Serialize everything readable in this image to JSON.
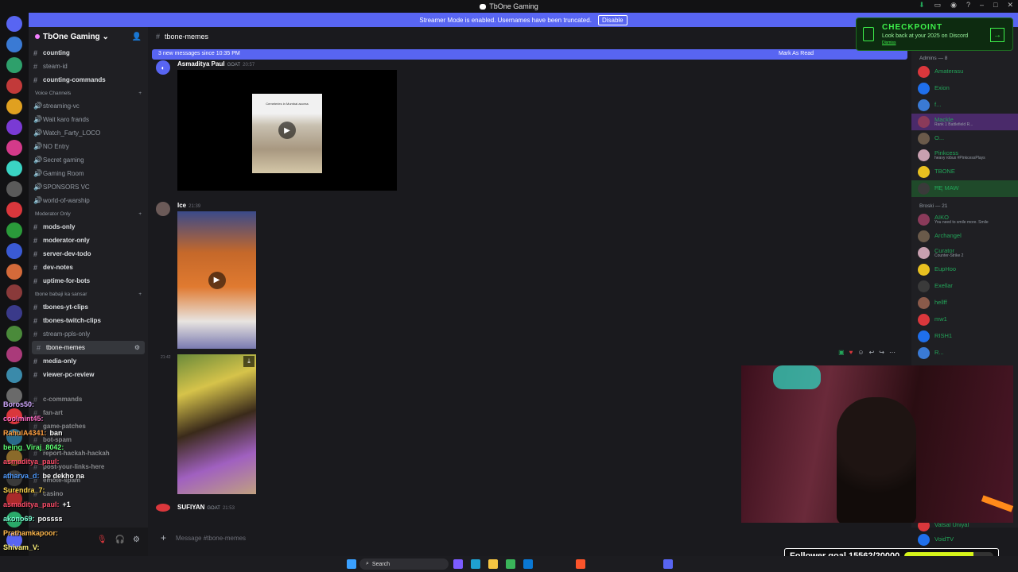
{
  "window": {
    "title": "TbOne Gaming"
  },
  "banner": {
    "text": "Streamer Mode is enabled. Usernames have been truncated.",
    "disable_label": "Disable"
  },
  "server": {
    "name": "TbOne Gaming"
  },
  "channels": [
    {
      "label": "counting",
      "style": "bright"
    },
    {
      "label": "steam-id",
      "style": "dim"
    },
    {
      "label": "counting-commands",
      "style": "bright"
    }
  ],
  "cat_voice": "Voice Channels",
  "voice": [
    "streaming-vc",
    "Wait karo frands",
    "Watch_Farty_LOCO",
    "NO Entry",
    "Secret gaming",
    "Gaming Room",
    "SPONSORS VC",
    "world-of-warship"
  ],
  "cat_mod": "Moderator Only",
  "mod": [
    {
      "label": "mods-only",
      "style": "bright"
    },
    {
      "label": "moderator-only",
      "style": "bright"
    },
    {
      "label": "server-dev-todo",
      "style": "bright"
    },
    {
      "label": "dev-notes",
      "style": "bright"
    },
    {
      "label": "uptime-for-bots",
      "style": "bright"
    }
  ],
  "cat_tbone": "tbone babaji ka sansar",
  "tbone": [
    {
      "label": "tbones-yt-clips",
      "style": "bright"
    },
    {
      "label": "tbones-twitch-clips",
      "style": "bright"
    },
    {
      "label": "stream-ppls-only",
      "style": "dim"
    },
    {
      "label": "tbone-memes",
      "style": "active"
    },
    {
      "label": "media-only",
      "style": "bright"
    },
    {
      "label": "viewer-pc-review",
      "style": "bright"
    }
  ],
  "lower_channels": [
    "c-commands",
    "fan-art",
    "game-patches",
    "bot-spam",
    "report-hackah-hackah",
    "post-your-links-here",
    "emote-spam",
    "casino"
  ],
  "channel_header": {
    "name": "tbone-memes"
  },
  "new_messages": {
    "text": "3 new messages since 10:35 PM",
    "mark": "Mark As Read"
  },
  "messages": [
    {
      "user": "Asmaditya Paul",
      "role": "GOAT",
      "time": "20:57",
      "media_caption": "Cemeteries in Mumbai access"
    },
    {
      "user": "Ice",
      "role": "",
      "time": "21:39"
    },
    {
      "time": "21:42"
    },
    {
      "user": "SUFIYAN",
      "role": "GOAT",
      "time": "21:53"
    }
  ],
  "composer": {
    "placeholder": "Message #tbone-memes"
  },
  "checkpoint": {
    "title": "CHECKPOINT",
    "subtitle": "Look back at your 2025 on Discord",
    "link": "Dismiss"
  },
  "members": {
    "admins_label": "Admins — 8",
    "admins": [
      {
        "name": "Amaterasu",
        "sub": "",
        "color": "#23a559"
      },
      {
        "name": "Exion",
        "sub": "",
        "color": "#23a559"
      },
      {
        "name": "f...",
        "sub": "",
        "color": "#23a559"
      },
      {
        "name": "Mackle",
        "sub": "Rank 1 Battlefield R...",
        "color": "#23a559"
      },
      {
        "name": "O...",
        "sub": "",
        "color": "#23a559"
      },
      {
        "name": "Pinkcess",
        "sub": "heavy robux #PinkcessPlays",
        "color": "#23a559"
      },
      {
        "name": "TBONE",
        "sub": "",
        "color": "#23a559"
      },
      {
        "name": "ĦĘ MAW",
        "sub": "",
        "color": "#23a559"
      }
    ],
    "broski_label": "Broski — 21",
    "broski": [
      {
        "name": "AIKO",
        "sub": "You need to smile more. Smile",
        "color": "#23a559"
      },
      {
        "name": "Archangel",
        "sub": "",
        "color": "#23a559"
      },
      {
        "name": "Curator",
        "sub": "Counter-Strike 2",
        "color": "#23a559"
      },
      {
        "name": "EupHoo",
        "sub": "",
        "color": "#23a559"
      },
      {
        "name": "Exellar",
        "sub": "",
        "color": "#23a559"
      },
      {
        "name": "hellff",
        "sub": "",
        "color": "#23a559"
      },
      {
        "name": "mw1",
        "sub": "",
        "color": "#23a559"
      },
      {
        "name": "RISH1",
        "sub": "",
        "color": "#23a559"
      },
      {
        "name": "R...",
        "sub": "",
        "color": "#23a559"
      }
    ],
    "bottom": [
      {
        "name": "Vatsal Uniyal",
        "color": "#23a559"
      },
      {
        "name": "VoidTV",
        "color": "#23a559"
      }
    ]
  },
  "chat_overlay": [
    {
      "user": "Boros50:",
      "msg": "",
      "color": "#d1a8ff"
    },
    {
      "user": "coolmint45:",
      "msg": "",
      "color": "#ff6ec7"
    },
    {
      "user": "RahulA4341:",
      "msg": "ban",
      "color": "#ff9f40"
    },
    {
      "user": "being_Viraj_8042:",
      "msg": "",
      "color": "#5dff72"
    },
    {
      "user": "asmaditya_paul:",
      "msg": "",
      "color": "#ff4d6a"
    },
    {
      "user": "atharva_d:",
      "msg": "be dekho na",
      "color": "#4d9aff"
    },
    {
      "user": "Surendra_7:",
      "msg": "",
      "color": "#ffd84d"
    },
    {
      "user": "asmaditya_paul:",
      "msg": "+1",
      "color": "#ff4d6a"
    },
    {
      "user": "akono69:",
      "msg": "possss",
      "color": "#7cffd4"
    },
    {
      "user": "Prathamkapoor:",
      "msg": "",
      "color": "#ffb84d"
    },
    {
      "user": "Shivam_V:",
      "msg": "",
      "color": "#fff27c"
    }
  ],
  "follower_goal": {
    "label": "Follower goal 15562/20000",
    "progress": 0.7781
  },
  "taskbar": {
    "search": "Search"
  },
  "colors": {
    "brand": "#5865f2",
    "online": "#23a559",
    "checkpoint": "#3ef24b",
    "goal_bar": "#d7f51a"
  }
}
